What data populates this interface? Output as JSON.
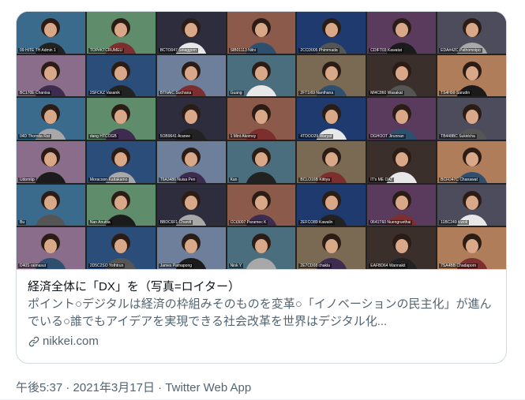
{
  "card": {
    "title": "経済全体に「DX」を（写真=ロイター）",
    "description": "ポイント○デジタルは経済の枠組みそのものを変革○「イノベーションの民主化」が進んでいる○誰でもアイデアを実現できる社会改革を世界はデジタル化...",
    "domain": "nikkei.com"
  },
  "meta": {
    "time": "午後5:37",
    "date": "2021年3月17日",
    "source": "Twitter Web App",
    "separator": " · "
  },
  "tiles": [
    {
      "label": "09 HITE TH Admin 1"
    },
    {
      "label": "TOP#KTCRUMEU"
    },
    {
      "label": "BCTO047 Siriaggorn"
    },
    {
      "label": "SIB01113 Nilni"
    },
    {
      "label": "2CCD005 Phimmada"
    },
    {
      "label": "CDIFT03 Kawatat"
    },
    {
      "label": "EDA#4ZC Pathomnipo"
    },
    {
      "label": "BC170E Chanisa"
    },
    {
      "label": "2SFCKZ Vasanik"
    },
    {
      "label": "BTNAIC Suchana"
    },
    {
      "label": "Guang"
    },
    {
      "label": "2FT1I69 Nanthana"
    },
    {
      "label": "Ml4C860 Wasakat"
    },
    {
      "label": "TS4H99 Sarudin"
    },
    {
      "label": "04D Thornita Rat"
    },
    {
      "label": "dang HTCOGB"
    },
    {
      "label": "5OB9641 Aranee"
    },
    {
      "label": "1 Mint Akomsy"
    },
    {
      "label": "4TDOO29 Waryat"
    },
    {
      "label": "DGHOOT Jirunnan"
    },
    {
      "label": "TB448BC Sukidcha"
    },
    {
      "label": "Udomtip"
    },
    {
      "label": "Moracoon Kattakamo"
    },
    {
      "label": "T6A3486 Nuisa Pen"
    },
    {
      "label": "Kan"
    },
    {
      "label": "BCLO16B Kittiya"
    },
    {
      "label": "IT's ME OAT"
    },
    {
      "label": "BCFD47C Chanawat"
    },
    {
      "label": "Bu"
    },
    {
      "label": "Nan Anuttia"
    },
    {
      "label": "BBDC6F1 Chanitt"
    },
    {
      "label": "CCt3007 Paramec K"
    },
    {
      "label": "2EFCO89 Kawalin"
    },
    {
      "label": "0641T60 Nuengruethai"
    },
    {
      "label": "11BC249 Kwok"
    },
    {
      "label": "D40S raimasut"
    },
    {
      "label": "2D5C2SO Yothtrun"
    },
    {
      "label": "James Pamapong"
    },
    {
      "label": "Nink Y"
    },
    {
      "label": "2E7CD08 chakla"
    },
    {
      "label": "EAFBD64 Wannakit"
    },
    {
      "label": "7SA4BB Chadaporn"
    }
  ]
}
